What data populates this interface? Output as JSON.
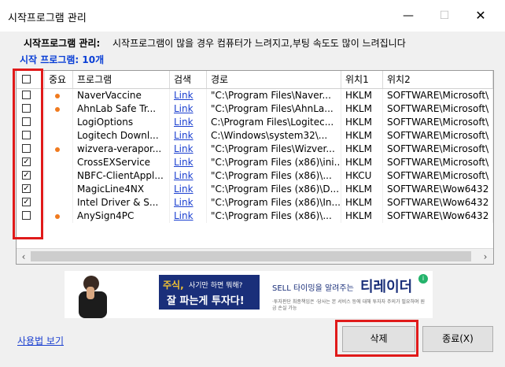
{
  "window": {
    "title": "시작프로그램 관리",
    "min_glyph": "—",
    "max_glyph": "☐",
    "close_glyph": "✕"
  },
  "header": {
    "label": "시작프로그램 관리:",
    "description": "시작프로그램이 많을 경우 컴퓨터가 느려지고,부팅 속도도 많이 느려집니다",
    "count_text": "시작 프로그램: 10개"
  },
  "table": {
    "columns": [
      "",
      "중요",
      "프로그램",
      "검색",
      "경로",
      "위치1",
      "위치2"
    ],
    "rows": [
      {
        "checked": false,
        "important": true,
        "program": "NaverVaccine",
        "search": "Link",
        "path": "\"C:\\Program Files\\Naver...",
        "loc1": "HKLM",
        "loc2": "SOFTWARE\\Microsoft\\"
      },
      {
        "checked": false,
        "important": true,
        "program": "AhnLab Safe Tr...",
        "search": "Link",
        "path": "\"C:\\Program Files\\AhnLa...",
        "loc1": "HKLM",
        "loc2": "SOFTWARE\\Microsoft\\"
      },
      {
        "checked": false,
        "important": false,
        "program": "LogiOptions",
        "search": "Link",
        "path": "C:\\Program Files\\Logitec...",
        "loc1": "HKLM",
        "loc2": "SOFTWARE\\Microsoft\\"
      },
      {
        "checked": false,
        "important": false,
        "program": "Logitech Downl...",
        "search": "Link",
        "path": "C:\\Windows\\system32\\...",
        "loc1": "HKLM",
        "loc2": "SOFTWARE\\Microsoft\\"
      },
      {
        "checked": false,
        "important": true,
        "program": "wizvera-verapor...",
        "search": "Link",
        "path": "\"C:\\Program Files\\Wizver...",
        "loc1": "HKLM",
        "loc2": "SOFTWARE\\Microsoft\\"
      },
      {
        "checked": true,
        "important": false,
        "program": "CrossEXService",
        "search": "Link",
        "path": "\"C:\\Program Files (x86)\\ini...",
        "loc1": "HKLM",
        "loc2": "SOFTWARE\\Microsoft\\"
      },
      {
        "checked": true,
        "important": false,
        "program": "NBFC-ClientAppl...",
        "search": "Link",
        "path": "\"C:\\Program Files (x86)\\...",
        "loc1": "HKCU",
        "loc2": "SOFTWARE\\Microsoft\\"
      },
      {
        "checked": true,
        "important": false,
        "program": "MagicLine4NX",
        "search": "Link",
        "path": "\"C:\\Program Files (x86)\\D...",
        "loc1": "HKLM",
        "loc2": "SOFTWARE\\Wow6432"
      },
      {
        "checked": true,
        "important": false,
        "program": "Intel Driver & S...",
        "search": "Link",
        "path": "\"C:\\Program Files (x86)\\In...",
        "loc1": "HKLM",
        "loc2": "SOFTWARE\\Wow6432"
      },
      {
        "checked": false,
        "important": true,
        "program": "AnySign4PC",
        "search": "Link",
        "path": "\"C:\\Program Files (x86)\\...",
        "loc1": "HKLM",
        "loc2": "SOFTWARE\\Wow6432"
      }
    ]
  },
  "banner": {
    "line1_accent": "주식,",
    "line1_rest": "사기만 하면 뭐해?",
    "line2": "잘 파는게 투자다!",
    "tagline": "SELL 타이밍을 알려주는",
    "brand": "티레이더",
    "footnote": "·투자판단 최종책임은 ·당사는 본 서비스 등에 대해 투자자 주의가 필요하며 원금 손실 가능",
    "colors": {
      "navy": "#1a2f7a",
      "accent": "#f2c230",
      "brand": "#24b36b"
    }
  },
  "footer": {
    "help_link": "사용법 보기",
    "delete_button": "삭제",
    "exit_button": "종료(X)"
  },
  "colors": {
    "highlight_red": "#e01a1a",
    "link_blue": "#1a3fd0",
    "count_blue": "#0a3fd6",
    "important_dot": "#f07a1e"
  }
}
